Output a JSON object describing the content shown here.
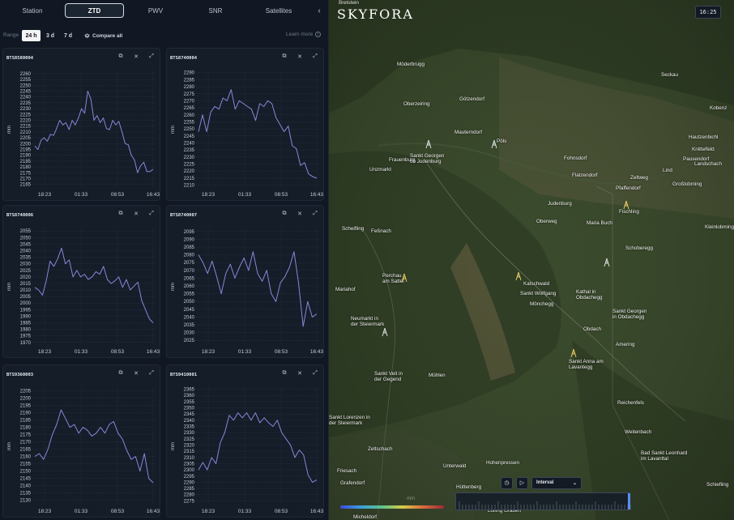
{
  "tabs": [
    {
      "label": "Station",
      "active": false
    },
    {
      "label": "ZTD",
      "active": true
    },
    {
      "label": "PWV",
      "active": false
    },
    {
      "label": "SNR",
      "active": false
    },
    {
      "label": "Satellites",
      "active": false
    }
  ],
  "collapse_icon": "chevron-left-icon",
  "range": {
    "label": "Range",
    "options": [
      {
        "label": "24 h",
        "active": true
      },
      {
        "label": "3 d",
        "active": false
      },
      {
        "label": "7 d",
        "active": false
      }
    ],
    "compare_label": "Compare all",
    "learn_more_label": "Learn more",
    "learn_more_icon": "info-icon"
  },
  "card_icons": [
    "copy-icon",
    "close-icon",
    "expand-icon"
  ],
  "charts": [
    {
      "title": "BTS8580004",
      "type": "line",
      "ylabel": "mm",
      "color": "#8b86d9",
      "yticks": [
        2165,
        2170,
        2175,
        2180,
        2185,
        2190,
        2195,
        2200,
        2205,
        2210,
        2215,
        2220,
        2225,
        2230,
        2235,
        2240,
        2245,
        2250,
        2255,
        2260
      ],
      "ylim": [
        2162,
        2262
      ],
      "xticks": [
        "18:23",
        "01:33",
        "08:53",
        "16:43"
      ],
      "values": [
        2198,
        2195,
        2203,
        2205,
        2202,
        2208,
        2207,
        2213,
        2220,
        2216,
        2218,
        2212,
        2220,
        2216,
        2222,
        2230,
        2226,
        2245,
        2238,
        2220,
        2224,
        2218,
        2222,
        2213,
        2212,
        2220,
        2216,
        2219,
        2210,
        2200,
        2199,
        2190,
        2186,
        2175,
        2181,
        2184,
        2176,
        2176,
        2178
      ]
    },
    {
      "title": "BTS8740004",
      "type": "line",
      "ylabel": "mm",
      "color": "#8b86d9",
      "yticks": [
        2210,
        2215,
        2220,
        2225,
        2230,
        2235,
        2240,
        2245,
        2250,
        2255,
        2260,
        2265,
        2270,
        2275,
        2280,
        2285,
        2290
      ],
      "ylim": [
        2208,
        2291
      ],
      "xticks": [
        "18:23",
        "01:33",
        "08:53",
        "16:43"
      ],
      "values": [
        2248,
        2260,
        2248,
        2262,
        2266,
        2264,
        2272,
        2270,
        2278,
        2264,
        2270,
        2268,
        2266,
        2264,
        2256,
        2268,
        2266,
        2270,
        2268,
        2258,
        2253,
        2248,
        2252,
        2238,
        2236,
        2224,
        2226,
        2218,
        2216,
        2215
      ]
    },
    {
      "title": "BTS8740006",
      "type": "line",
      "ylabel": "mm",
      "color": "#8b86d9",
      "yticks": [
        1970,
        1975,
        1980,
        1985,
        1990,
        1995,
        2000,
        2005,
        2010,
        2015,
        2020,
        2025,
        2030,
        2035,
        2040,
        2045,
        2050,
        2055
      ],
      "ylim": [
        1968,
        2057
      ],
      "xticks": [
        "18:23",
        "01:33",
        "08:53",
        "16:43"
      ],
      "values": [
        2012,
        2010,
        2006,
        2017,
        2032,
        2028,
        2034,
        2042,
        2030,
        2033,
        2020,
        2025,
        2020,
        2022,
        2018,
        2020,
        2024,
        2022,
        2028,
        2018,
        2015,
        2017,
        2020,
        2012,
        2018,
        2010,
        2013,
        2016,
        2002,
        1995,
        1988,
        1985
      ]
    },
    {
      "title": "BTS8740007",
      "type": "line",
      "ylabel": "mm",
      "color": "#8b86d9",
      "yticks": [
        2025,
        2030,
        2035,
        2040,
        2045,
        2050,
        2055,
        2060,
        2065,
        2070,
        2075,
        2080,
        2085,
        2090,
        2095
      ],
      "ylim": [
        2022,
        2097
      ],
      "xticks": [
        "18:23",
        "01:33",
        "08:53",
        "16:43"
      ],
      "values": [
        2080,
        2075,
        2068,
        2076,
        2066,
        2055,
        2068,
        2074,
        2065,
        2072,
        2078,
        2070,
        2082,
        2068,
        2063,
        2070,
        2055,
        2050,
        2062,
        2066,
        2072,
        2082,
        2062,
        2034,
        2050,
        2040,
        2042
      ]
    },
    {
      "title": "BTS9360003",
      "type": "line",
      "ylabel": "mm",
      "color": "#8b86d9",
      "yticks": [
        2130,
        2135,
        2140,
        2145,
        2150,
        2155,
        2160,
        2165,
        2170,
        2175,
        2180,
        2185,
        2190,
        2195,
        2200,
        2205
      ],
      "ylim": [
        2127,
        2207
      ],
      "xticks": [
        "18:23",
        "01:33",
        "08:53",
        "16:43"
      ],
      "values": [
        2160,
        2162,
        2158,
        2165,
        2175,
        2182,
        2192,
        2186,
        2180,
        2182,
        2176,
        2180,
        2178,
        2174,
        2176,
        2180,
        2176,
        2182,
        2184,
        2176,
        2172,
        2164,
        2158,
        2160,
        2150,
        2162,
        2145,
        2142
      ]
    },
    {
      "title": "BTS9410001",
      "type": "line",
      "ylabel": "mm",
      "color": "#8b86d9",
      "yticks": [
        2275,
        2280,
        2285,
        2290,
        2295,
        2300,
        2305,
        2310,
        2315,
        2320,
        2325,
        2330,
        2335,
        2340,
        2345,
        2350,
        2355,
        2360,
        2365
      ],
      "ylim": [
        2272,
        2366
      ],
      "xticks": [
        "18:23",
        "01:33",
        "08:53",
        "16:43"
      ],
      "values": [
        2300,
        2306,
        2300,
        2310,
        2305,
        2322,
        2330,
        2344,
        2340,
        2346,
        2342,
        2346,
        2340,
        2346,
        2338,
        2342,
        2338,
        2335,
        2340,
        2330,
        2325,
        2320,
        2310,
        2316,
        2312,
        2296,
        2290,
        2292
      ]
    }
  ],
  "map": {
    "logo": "SKYFORA",
    "clock": "16:25",
    "labels": [
      {
        "text": "Bretstein"
      },
      {
        "text": "Möderbrugg"
      },
      {
        "text": "Seckau"
      },
      {
        "text": "Oberzeiring"
      },
      {
        "text": "Kobenz"
      },
      {
        "text": "Götzendorf"
      },
      {
        "text": "Mauterndorf"
      },
      {
        "text": "Pöls"
      },
      {
        "text": "Hautzenbichl"
      },
      {
        "text": "Knittelfeld"
      },
      {
        "text": "Frauenburg"
      },
      {
        "text": "Sankt Georgen\nob Judenburg"
      },
      {
        "text": "Fohnsdorf"
      },
      {
        "text": "Pausendorf"
      },
      {
        "text": "Landschach"
      },
      {
        "text": "Unzmarkt"
      },
      {
        "text": "Flatzendorf"
      },
      {
        "text": "Zeltweg"
      },
      {
        "text": "Lind"
      },
      {
        "text": "Pfaffendorf"
      },
      {
        "text": "Großlobming"
      },
      {
        "text": "Judenburg"
      },
      {
        "text": "Fischling"
      },
      {
        "text": "Oberweg"
      },
      {
        "text": "Maria Buch"
      },
      {
        "text": "Kleinlobming"
      },
      {
        "text": "Scheifling"
      },
      {
        "text": "Feßnach"
      },
      {
        "text": "Schoberegg"
      },
      {
        "text": "Perchau\nam Sattel"
      },
      {
        "text": "Katschwald"
      },
      {
        "text": "Kathal in\nObdachegg"
      },
      {
        "text": "Mariahof"
      },
      {
        "text": "Sankt Wolfgang"
      },
      {
        "text": "Mönchegg"
      },
      {
        "text": "Sankt Georgen\nin Obdachegg"
      },
      {
        "text": "Neumarkt in\nder Steiermark"
      },
      {
        "text": "Obdach"
      },
      {
        "text": "Amering"
      },
      {
        "text": "Sankt Anna am\nLavantegg"
      },
      {
        "text": "Sankt Veit in\nder Gegend"
      },
      {
        "text": "Mühlen"
      },
      {
        "text": "Reichenfels"
      },
      {
        "text": "Sankt Lorenzen in\nder Steiermark"
      },
      {
        "text": "Weitenbach"
      },
      {
        "text": "Zeltschach"
      },
      {
        "text": "Bad Sankt Leonhard\nim Lavanttal"
      },
      {
        "text": "Friesach"
      },
      {
        "text": "Unterwald"
      },
      {
        "text": "Hohenpressen"
      },
      {
        "text": "Grafendorf"
      },
      {
        "text": "Hüttenberg"
      },
      {
        "text": "Schiefling"
      },
      {
        "text": "Micheldorf"
      },
      {
        "text": "Lölling Graben"
      }
    ],
    "legend_unit": "mm",
    "play_controls": {
      "clock_icon": "clock-icon",
      "play_icon": "play-icon",
      "interval_label": "Interval",
      "interval_icon": "chevron-down-icon"
    }
  },
  "colors": {
    "accent": "#8b86d9",
    "panel": "#111823",
    "card": "#151d29",
    "timeline_handle": "#5b8cff"
  }
}
